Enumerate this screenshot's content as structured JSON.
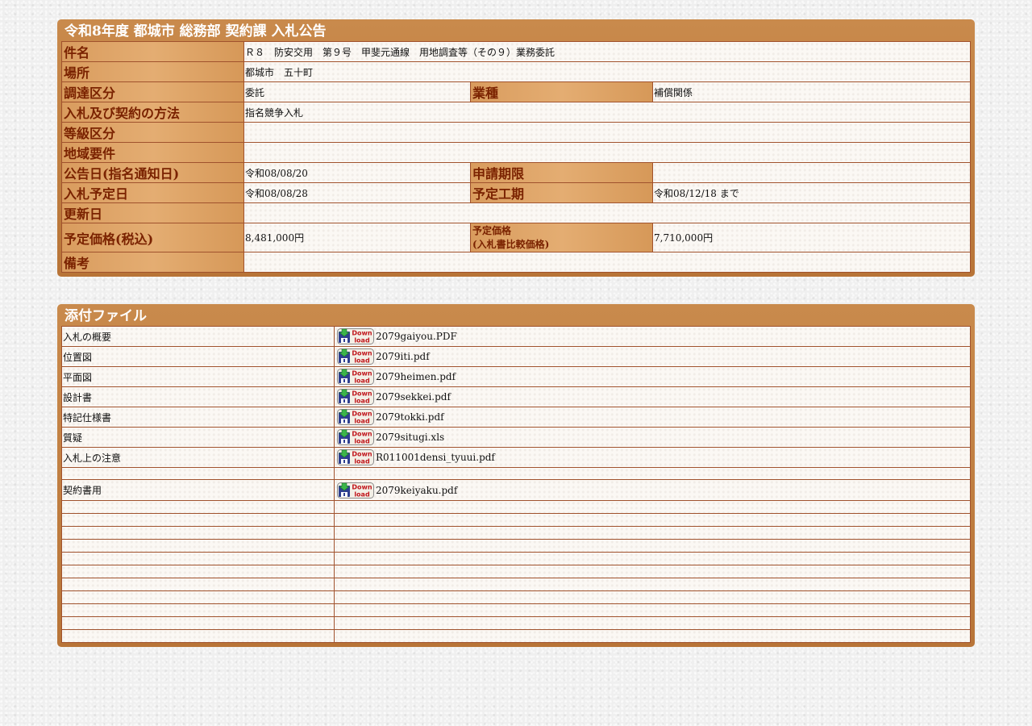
{
  "notice": {
    "title": "令和8年度 都城市 総務部 契約課 入札公告",
    "rows": {
      "kenmei_label": "件名",
      "kenmei_value": "Ｒ８　防安交用　第９号　甲斐元通線　用地調査等（その９）業務委託",
      "basho_label": "場所",
      "basho_value": "都城市　五十町",
      "chotatsu_label": "調達区分",
      "chotatsu_value": "委託",
      "gyoshu_label": "業種",
      "gyoshu_value": "補償関係",
      "hoho_label": "入札及び契約の方法",
      "hoho_value": "指名競争入札",
      "tokyu_label": "等級区分",
      "tokyu_value": "",
      "chiiki_label": "地域要件",
      "chiiki_value": "",
      "kokoku_label": "公告日(指名通知日)",
      "kokoku_value": "令和08/08/20",
      "shinsei_label": "申請期限",
      "shinsei_value": "",
      "nyusatsu_label": "入札予定日",
      "nyusatsu_value": "令和08/08/28",
      "koki_label": "予定工期",
      "koki_value": "令和08/12/18 まで",
      "koshin_label": "更新日",
      "koshin_value": "",
      "kakaku_label": "予定価格(税込)",
      "kakaku_value": "8,481,000円",
      "hikaku_label_1": "予定価格",
      "hikaku_label_2": "(入札書比較価格)",
      "hikaku_value": "7,710,000円",
      "biko_label": "備考",
      "biko_value": ""
    }
  },
  "attachments": {
    "title": "添付ファイル",
    "download_icon_text": "Down load",
    "files": [
      {
        "label": "入札の概要",
        "file": "2079gaiyou.PDF"
      },
      {
        "label": "位置図",
        "file": "2079iti.pdf"
      },
      {
        "label": "平面図",
        "file": "2079heimen.pdf"
      },
      {
        "label": "設計書",
        "file": "2079sekkei.pdf"
      },
      {
        "label": "特記仕様書",
        "file": "2079tokki.pdf"
      },
      {
        "label": "質疑",
        "file": "2079situgi.xls"
      },
      {
        "label": "入札上の注意",
        "file": "R011001densi_tyuui.pdf"
      }
    ],
    "contract": {
      "label": "契約書用",
      "file": "2079keiyaku.pdf"
    }
  },
  "colors": {
    "frame": "#c07d40",
    "label_bg": "#e0a56a",
    "label_text": "#7a2200",
    "border": "#a0522d"
  }
}
